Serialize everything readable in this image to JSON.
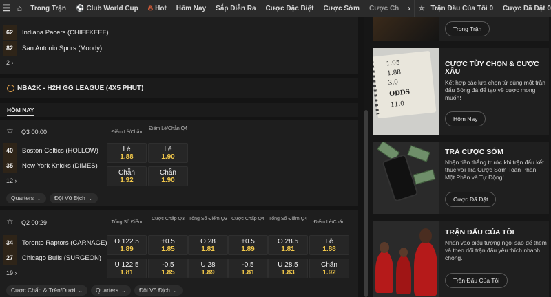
{
  "nav": {
    "items": [
      {
        "label": "Trong Trận",
        "icon": ""
      },
      {
        "label": "Club World Cup",
        "icon": "soccer-ball-icon"
      },
      {
        "label": "Hot",
        "icon": "fire-icon"
      },
      {
        "label": "Hôm Nay",
        "icon": ""
      },
      {
        "label": "Sắp Diễn Ra",
        "icon": ""
      },
      {
        "label": "Cược Đặc Biệt",
        "icon": ""
      },
      {
        "label": "Cược Sớm",
        "icon": ""
      },
      {
        "label": "Cược Ch",
        "icon": ""
      }
    ],
    "my_matches": "Trận Đấu Của Tôi 0",
    "placed_bets": "Cược Đã Đặt 0"
  },
  "prev_card": {
    "teams": [
      {
        "num": "62",
        "name": "Indiana Pacers (CHIEFKEEF)"
      },
      {
        "num": "82",
        "name": "San Antonio Spurs (Moody)"
      }
    ],
    "more": "2 ›"
  },
  "league": {
    "name": "NBA2K - H2H GG LEAGUE (4X5 PHUT)"
  },
  "today_label": "HÔM NAY",
  "match1": {
    "time": "Q3 00:00",
    "headers": [
      "Điểm Lẻ/Chẵn",
      "Điểm Lẻ/Chẵn Q4"
    ],
    "teams": [
      {
        "num": "40",
        "name": "Boston Celtics (HOLLOW)"
      },
      {
        "num": "35",
        "name": "New York Knicks (DIMES)"
      }
    ],
    "odds": [
      [
        {
          "label": "Lẻ",
          "value": "1.88"
        },
        {
          "label": "Lẻ",
          "value": "1.90"
        }
      ],
      [
        {
          "label": "Chẵn",
          "value": "1.92"
        },
        {
          "label": "Chẵn",
          "value": "1.90"
        }
      ]
    ],
    "more": "12 ›",
    "filters": [
      "Quarters",
      "Đội Vô Địch"
    ]
  },
  "match2": {
    "time": "Q2 00:29",
    "headers": [
      "Tổng Số Điểm",
      "Cược Chấp Q3",
      "Tổng Số Điểm Q3",
      "Cược Chấp Q4",
      "Tổng Số Điểm Q4",
      "Điểm Lẻ/Chẵn"
    ],
    "teams": [
      {
        "num": "34",
        "name": "Toronto Raptors (CARNAGE)"
      },
      {
        "num": "27",
        "name": "Chicago Bulls (SURGEON)"
      }
    ],
    "odds": [
      [
        {
          "label": "O 122.5",
          "value": "1.89"
        },
        {
          "label": "+0.5",
          "value": "1.85"
        },
        {
          "label": "O 28",
          "value": "1.81"
        },
        {
          "label": "+0.5",
          "value": "1.89"
        },
        {
          "label": "O 28.5",
          "value": "1.81"
        },
        {
          "label": "Lẻ",
          "value": "1.88"
        }
      ],
      [
        {
          "label": "U 122.5",
          "value": "1.81"
        },
        {
          "label": "-0.5",
          "value": "1.85"
        },
        {
          "label": "U 28",
          "value": "1.89"
        },
        {
          "label": "-0.5",
          "value": "1.81"
        },
        {
          "label": "U 28.5",
          "value": "1.83"
        },
        {
          "label": "Chẵn",
          "value": "1.92"
        }
      ]
    ],
    "more": "19 ›",
    "filters": [
      "Cược Chấp & Trên/Dưới",
      "Quarters",
      "Đội Vô Địch"
    ]
  },
  "promos": [
    {
      "title": "",
      "text": "",
      "button": "Trong Trận"
    },
    {
      "title": "CƯỢC TÙY CHỌN & CƯỢC XÂU",
      "text": "Kết hợp các lựa chọn từ cùng một trận đấu Bóng đá để tạo về cược mong muốn!",
      "button": "Hôm Nay"
    },
    {
      "title": "TRẢ CƯỢC SỚM",
      "text": "Nhận tiền thắng trước khi trận đấu kết thúc với Trả Cược Sớm Toàn Phần, Một Phần và Tự Động!",
      "button": "Cược Đã Đặt"
    },
    {
      "title": "TRẬN ĐẤU CỦA TÔI",
      "text": "Nhấn vào biểu tượng ngôi sao để thêm và theo dõi trận đấu yêu thích nhanh chóng.",
      "button": "Trận Đấu Của Tôi"
    }
  ],
  "notebook_text": [
    "1.95",
    "1.88",
    "3.0",
    "ODDS",
    "11.0"
  ],
  "colors": {
    "odds_value": "#f3c94b",
    "accent": "#d89b4a"
  }
}
